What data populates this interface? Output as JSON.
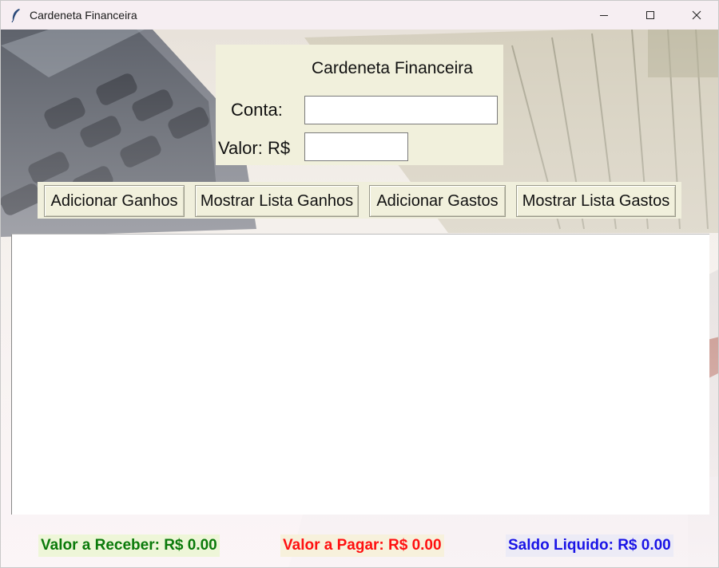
{
  "window": {
    "title": "Cardeneta Financeira",
    "controls": {
      "minimize": "minimize-icon",
      "maximize": "maximize-icon",
      "close": "close-icon"
    }
  },
  "header": {
    "title": "Cardeneta Financeira",
    "conta_label": "Conta:",
    "conta_value": "",
    "valor_label": "Valor: R$",
    "valor_value": ""
  },
  "buttons": {
    "add_income": "Adicionar Ganhos",
    "show_income": "Mostrar Lista Ganhos",
    "add_expense": "Adicionar Gastos",
    "show_expense": "Mostrar Lista Gastos"
  },
  "list": {
    "items": []
  },
  "totals": {
    "receber": "Valor a Receber: R$ 0.00",
    "pagar": "Valor a Pagar: R$ 0.00",
    "saldo": "Saldo Liquido: R$ 0.00"
  },
  "colors": {
    "panel_bg": "#f1f0dc",
    "receber": "#0a7a0a",
    "pagar": "#ff1010",
    "saldo": "#1a14e6"
  }
}
